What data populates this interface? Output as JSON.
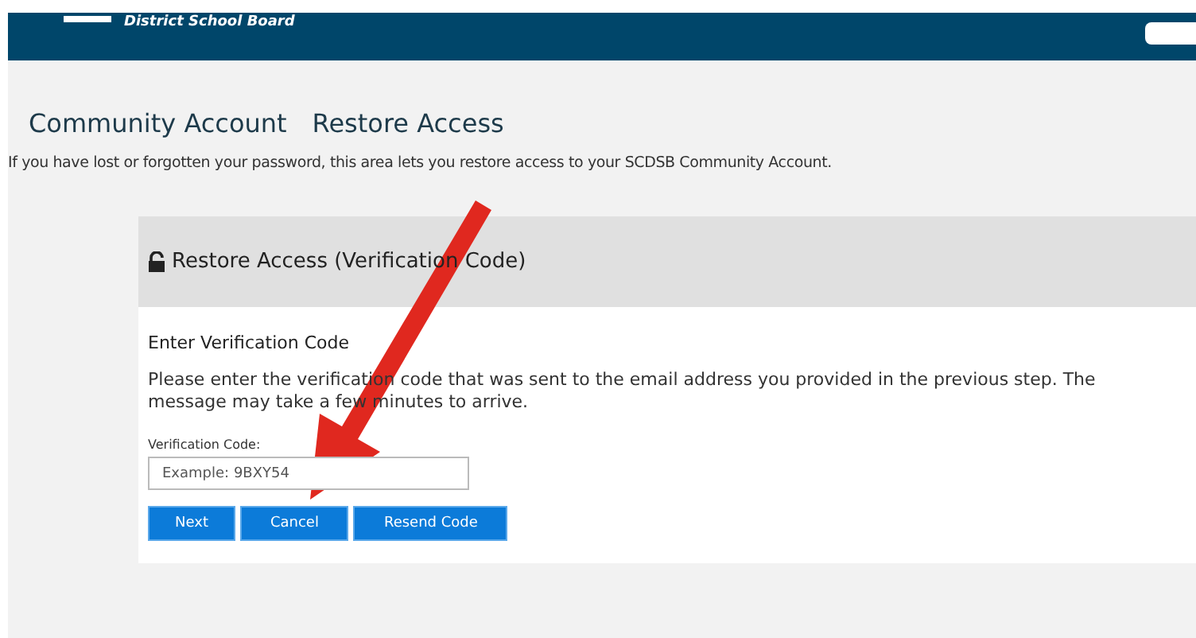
{
  "header": {
    "org_name": "District School Board"
  },
  "breadcrumb": [
    "Community Account",
    "Restore Access"
  ],
  "intro": "If you have lost or forgotten your password, this area lets you restore access to your SCDSB Community Account.",
  "panel": {
    "title": "Restore Access (Verification Code)",
    "section_title": "Enter Verification Code",
    "message": "Please enter the verification code that was sent to the email address you provided in the previous step. The message may take a few minutes to arrive.",
    "field": {
      "label": "Verification Code:",
      "placeholder": "Example: 9BXY54"
    },
    "buttons": [
      "Next",
      "Cancel",
      "Resend Code"
    ]
  }
}
